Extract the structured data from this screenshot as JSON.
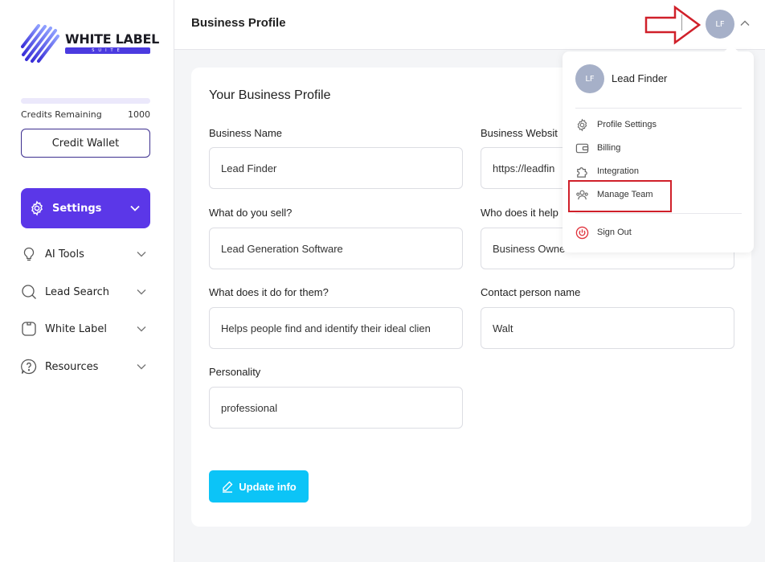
{
  "app": {
    "logo_text": "WHITE LABEL",
    "logo_subtext": "SUITE"
  },
  "sidebar": {
    "credits_label": "Credits Remaining",
    "credits_value": "1000",
    "credit_wallet_label": "Credit Wallet",
    "settings_label": "Settings",
    "items": [
      {
        "label": "AI Tools",
        "icon": "lightbulb-icon"
      },
      {
        "label": "Lead Search",
        "icon": "search-icon"
      },
      {
        "label": "White Label",
        "icon": "tag-icon"
      },
      {
        "label": "Resources",
        "icon": "help-circle-icon"
      }
    ]
  },
  "header": {
    "title": "Business Profile",
    "avatar_initials": "LF"
  },
  "form": {
    "title": "Your Business Profile",
    "business_name": {
      "label": "Business Name",
      "value": "Lead Finder"
    },
    "business_website": {
      "label": "Business Websit",
      "value": "https://leadfin"
    },
    "what_sell": {
      "label": "What do you sell?",
      "value": "Lead Generation Software"
    },
    "who_helps": {
      "label": "Who does it help",
      "value": "Business Owne"
    },
    "what_does": {
      "label": "What does it do for them?",
      "value": "Helps people find and identify their ideal clien"
    },
    "contact_person": {
      "label": "Contact person name",
      "value": "Walt"
    },
    "personality": {
      "label": "Personality",
      "value": "professional"
    },
    "update_label": "Update info"
  },
  "dropdown": {
    "avatar_initials": "LF",
    "user_name": "Lead Finder",
    "items": [
      {
        "label": "Profile Settings",
        "icon": "gear-icon"
      },
      {
        "label": "Billing",
        "icon": "wallet-icon"
      },
      {
        "label": "Integration",
        "icon": "puzzle-icon"
      },
      {
        "label": "Manage Team",
        "icon": "team-icon"
      }
    ],
    "signout_label": "Sign Out"
  },
  "colors": {
    "primary": "#5b37e8",
    "accent": "#0cc4f7",
    "annotation_red": "#d0202a"
  }
}
